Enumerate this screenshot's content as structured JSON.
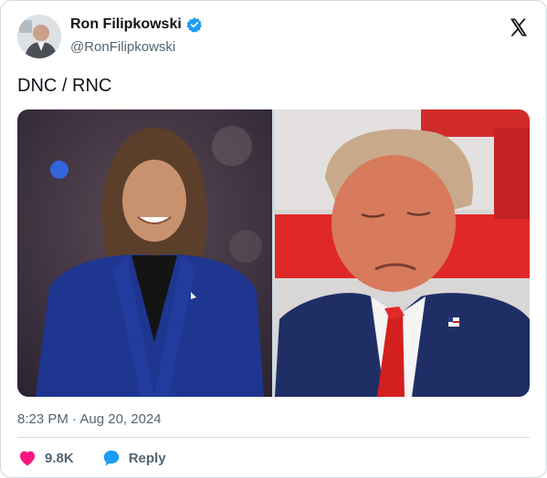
{
  "author": {
    "name": "Ron Filipkowski",
    "handle": "@RonFilipkowski"
  },
  "tweet": {
    "text": "DNC / RNC",
    "timestamp": "8:23 PM · Aug 20, 2024"
  },
  "stats": {
    "likes": "9.8K",
    "reply_label": "Reply"
  },
  "colors": {
    "like": "#f91880",
    "reply": "#1d9bf0",
    "verified": "#1d9bf0"
  },
  "icons": {
    "logo": "x-logo-icon",
    "verified": "verified-badge-icon",
    "like": "heart-icon",
    "reply": "speech-bubble-icon"
  }
}
